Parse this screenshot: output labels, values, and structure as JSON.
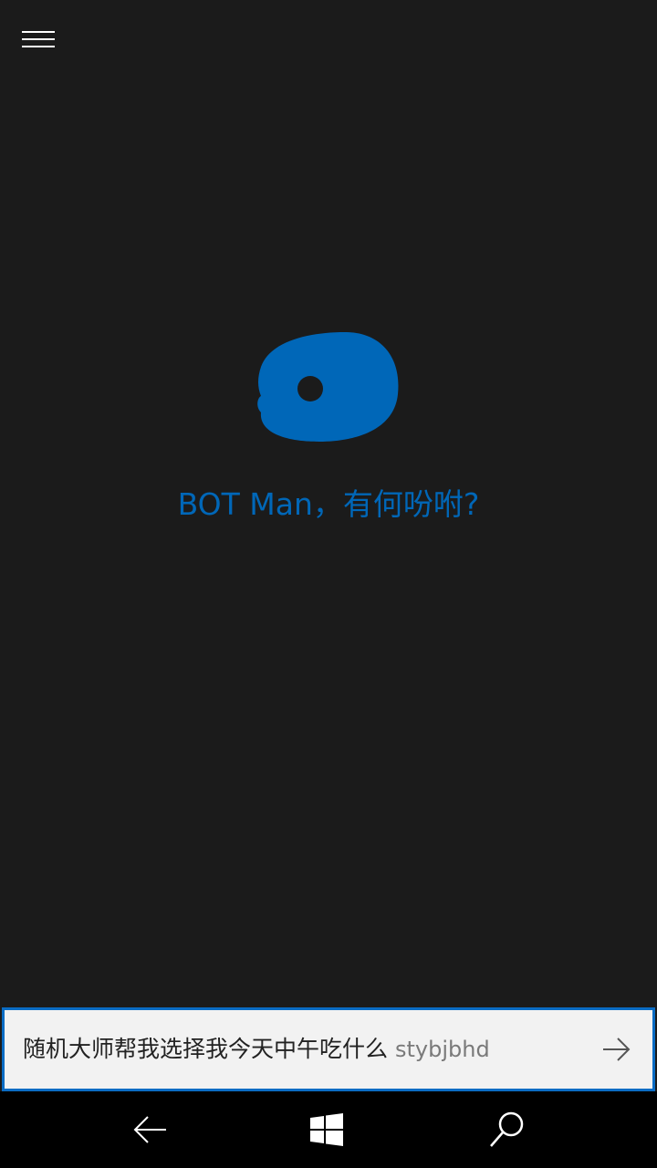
{
  "header": {
    "menu_icon": "hamburger-menu-icon"
  },
  "assistant": {
    "logo_icon": "cortana-logo-icon",
    "greeting": "BOT Man，有何吩咐?"
  },
  "input": {
    "typed_text": "随机大师帮我选择我今天中午吃什么",
    "composing_text": "stybjbhd",
    "send_icon": "arrow-right-icon"
  },
  "nav": {
    "back_icon": "back-arrow-icon",
    "home_icon": "windows-logo-icon",
    "search_icon": "search-icon"
  },
  "colors": {
    "background": "#1b1b1b",
    "accent": "#0067b8",
    "input_border": "#0a6cc4",
    "input_background": "#f2f2f2",
    "nav_background": "#000000"
  }
}
